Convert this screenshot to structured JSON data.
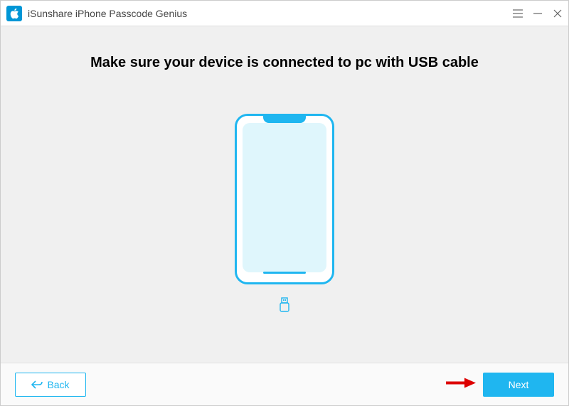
{
  "app": {
    "title": "iSunshare iPhone Passcode Genius"
  },
  "heading": "Make sure your device is connected to pc with USB cable",
  "buttons": {
    "back": "Back",
    "next": "Next"
  }
}
